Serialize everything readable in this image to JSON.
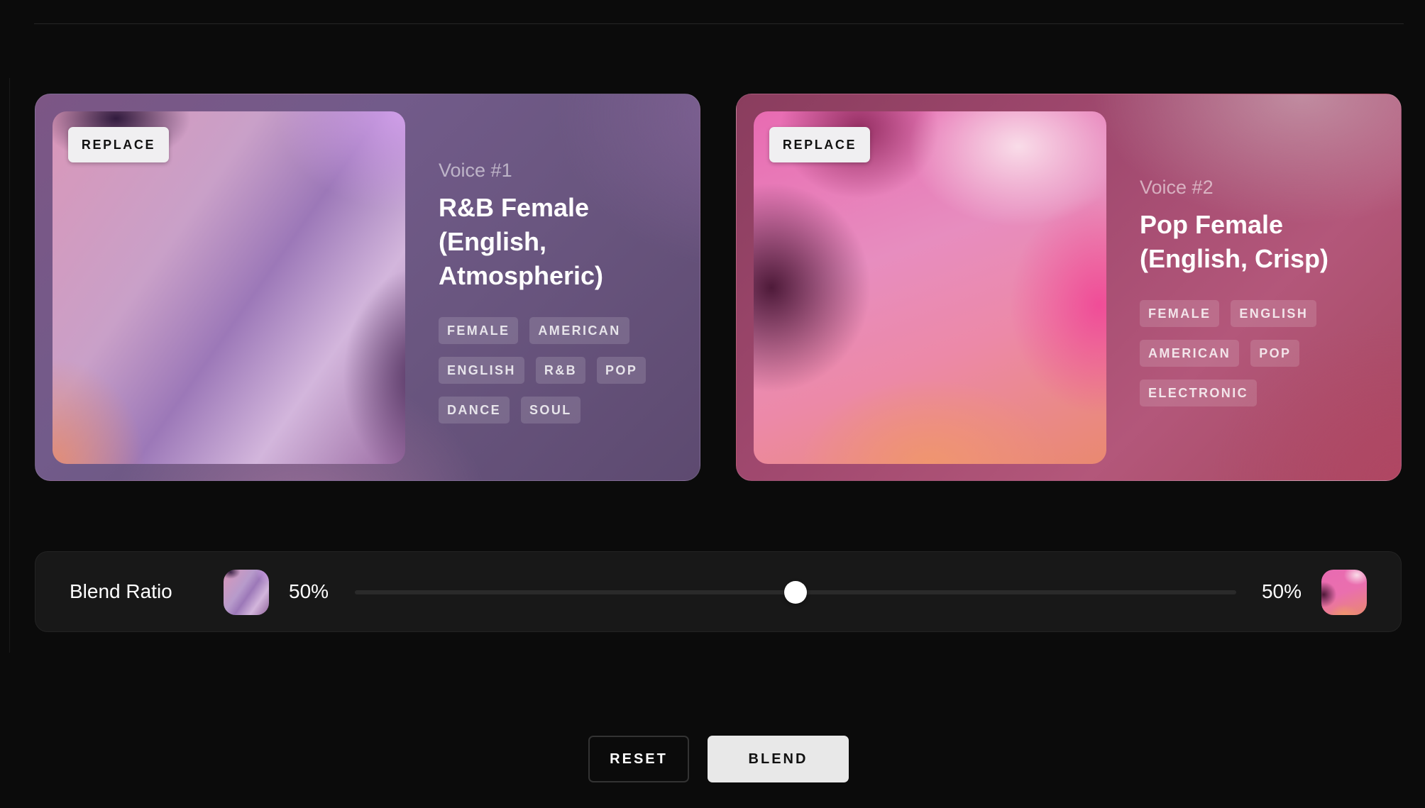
{
  "voices": [
    {
      "replace_label": "REPLACE",
      "number": "Voice #1",
      "title": "R&B Female (English, Atmospheric)",
      "tags": [
        "FEMALE",
        "AMERICAN",
        "ENGLISH",
        "R&B",
        "POP",
        "DANCE",
        "SOUL"
      ],
      "accent": "#725b8a"
    },
    {
      "replace_label": "REPLACE",
      "number": "Voice #2",
      "title": "Pop Female (English, Crisp)",
      "tags": [
        "FEMALE",
        "ENGLISH",
        "AMERICAN",
        "POP",
        "ELECTRONIC"
      ],
      "accent": "#a1496f"
    }
  ],
  "blend": {
    "label": "Blend Ratio",
    "left_percent": "50%",
    "right_percent": "50%",
    "ratio": 0.5
  },
  "actions": {
    "reset_label": "RESET",
    "blend_label": "BLEND"
  },
  "colors": {
    "background": "#0b0b0b",
    "panel": "#181818",
    "primary_button": "#e8e8e8"
  }
}
